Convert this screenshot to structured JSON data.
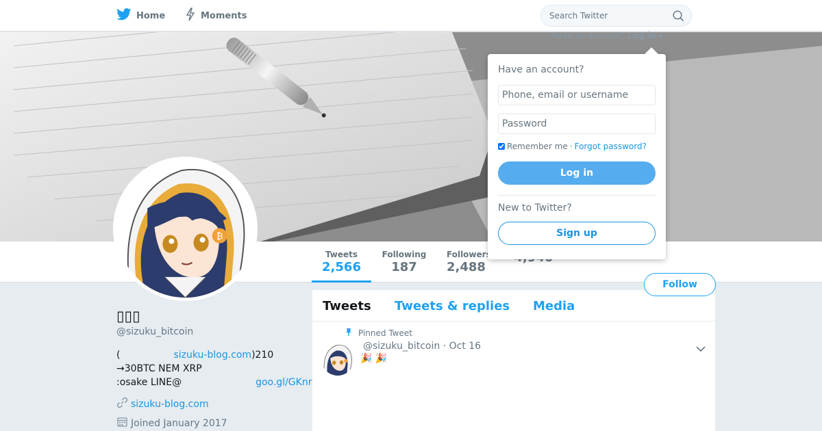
{
  "nav": {
    "home_label": "Home",
    "moments_label": "Moments",
    "search_placeholder": "Search Twitter",
    "brand_color": "#1da1f2"
  },
  "account_prompt": {
    "text": "Have an account?",
    "login_label": "Log in"
  },
  "login_dropdown": {
    "title": "Have an account?",
    "username_placeholder": "Phone, email or username",
    "password_placeholder": "Password",
    "remember_label": "Remember me",
    "separator": "·",
    "forgot_label": "Forgot password?",
    "login_button": "Log in",
    "new_label": "New to Twitter?",
    "signup_button": "Sign up"
  },
  "stats": {
    "tweets_label": "Tweets",
    "tweets_value": "2,566",
    "following_label": "Following",
    "following_value": "187",
    "followers_label": "Followers",
    "followers_value": "2,488",
    "likes_value": "4,940"
  },
  "follow_button": "Follow",
  "profile": {
    "name": "▯▯▯",
    "handle": "@sizuku_bitcoin",
    "bio_line1_prefix": "(",
    "bio_line1_link": "sizuku-blog.com",
    "bio_line1_suffix": ")210",
    "bio_line2": "→30BTC NEM XRP",
    "bio_line3_prefix": ":osake LINE@",
    "bio_line3_link": "goo.gl/GKnr",
    "url": "sizuku-blog.com",
    "joined": "Joined January 2017"
  },
  "timeline": {
    "tabs": [
      "Tweets",
      "Tweets & replies",
      "Media"
    ],
    "pinned_label": "Pinned Tweet",
    "tweet_handle": "@sizuku_bitcoin",
    "tweet_date_sep": "·",
    "tweet_date": "Oct 16",
    "tweet_text": "🎉 🎉"
  }
}
